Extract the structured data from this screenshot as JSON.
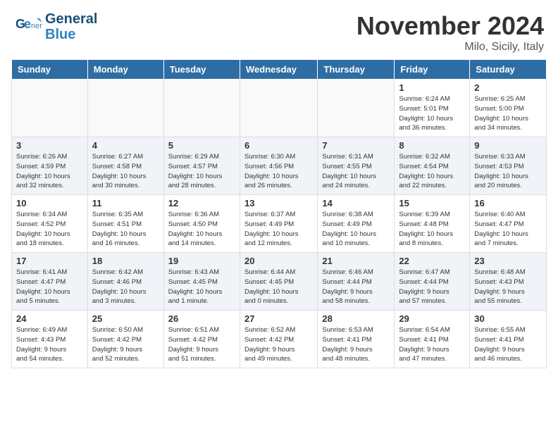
{
  "header": {
    "logo_line1": "General",
    "logo_line2": "Blue",
    "month": "November 2024",
    "location": "Milo, Sicily, Italy"
  },
  "days_of_week": [
    "Sunday",
    "Monday",
    "Tuesday",
    "Wednesday",
    "Thursday",
    "Friday",
    "Saturday"
  ],
  "weeks": [
    [
      {
        "num": "",
        "info": ""
      },
      {
        "num": "",
        "info": ""
      },
      {
        "num": "",
        "info": ""
      },
      {
        "num": "",
        "info": ""
      },
      {
        "num": "",
        "info": ""
      },
      {
        "num": "1",
        "info": "Sunrise: 6:24 AM\nSunset: 5:01 PM\nDaylight: 10 hours\nand 36 minutes."
      },
      {
        "num": "2",
        "info": "Sunrise: 6:25 AM\nSunset: 5:00 PM\nDaylight: 10 hours\nand 34 minutes."
      }
    ],
    [
      {
        "num": "3",
        "info": "Sunrise: 6:26 AM\nSunset: 4:59 PM\nDaylight: 10 hours\nand 32 minutes."
      },
      {
        "num": "4",
        "info": "Sunrise: 6:27 AM\nSunset: 4:58 PM\nDaylight: 10 hours\nand 30 minutes."
      },
      {
        "num": "5",
        "info": "Sunrise: 6:29 AM\nSunset: 4:57 PM\nDaylight: 10 hours\nand 28 minutes."
      },
      {
        "num": "6",
        "info": "Sunrise: 6:30 AM\nSunset: 4:56 PM\nDaylight: 10 hours\nand 26 minutes."
      },
      {
        "num": "7",
        "info": "Sunrise: 6:31 AM\nSunset: 4:55 PM\nDaylight: 10 hours\nand 24 minutes."
      },
      {
        "num": "8",
        "info": "Sunrise: 6:32 AM\nSunset: 4:54 PM\nDaylight: 10 hours\nand 22 minutes."
      },
      {
        "num": "9",
        "info": "Sunrise: 6:33 AM\nSunset: 4:53 PM\nDaylight: 10 hours\nand 20 minutes."
      }
    ],
    [
      {
        "num": "10",
        "info": "Sunrise: 6:34 AM\nSunset: 4:52 PM\nDaylight: 10 hours\nand 18 minutes."
      },
      {
        "num": "11",
        "info": "Sunrise: 6:35 AM\nSunset: 4:51 PM\nDaylight: 10 hours\nand 16 minutes."
      },
      {
        "num": "12",
        "info": "Sunrise: 6:36 AM\nSunset: 4:50 PM\nDaylight: 10 hours\nand 14 minutes."
      },
      {
        "num": "13",
        "info": "Sunrise: 6:37 AM\nSunset: 4:49 PM\nDaylight: 10 hours\nand 12 minutes."
      },
      {
        "num": "14",
        "info": "Sunrise: 6:38 AM\nSunset: 4:49 PM\nDaylight: 10 hours\nand 10 minutes."
      },
      {
        "num": "15",
        "info": "Sunrise: 6:39 AM\nSunset: 4:48 PM\nDaylight: 10 hours\nand 8 minutes."
      },
      {
        "num": "16",
        "info": "Sunrise: 6:40 AM\nSunset: 4:47 PM\nDaylight: 10 hours\nand 7 minutes."
      }
    ],
    [
      {
        "num": "17",
        "info": "Sunrise: 6:41 AM\nSunset: 4:47 PM\nDaylight: 10 hours\nand 5 minutes."
      },
      {
        "num": "18",
        "info": "Sunrise: 6:42 AM\nSunset: 4:46 PM\nDaylight: 10 hours\nand 3 minutes."
      },
      {
        "num": "19",
        "info": "Sunrise: 6:43 AM\nSunset: 4:45 PM\nDaylight: 10 hours\nand 1 minute."
      },
      {
        "num": "20",
        "info": "Sunrise: 6:44 AM\nSunset: 4:45 PM\nDaylight: 10 hours\nand 0 minutes."
      },
      {
        "num": "21",
        "info": "Sunrise: 6:46 AM\nSunset: 4:44 PM\nDaylight: 9 hours\nand 58 minutes."
      },
      {
        "num": "22",
        "info": "Sunrise: 6:47 AM\nSunset: 4:44 PM\nDaylight: 9 hours\nand 57 minutes."
      },
      {
        "num": "23",
        "info": "Sunrise: 6:48 AM\nSunset: 4:43 PM\nDaylight: 9 hours\nand 55 minutes."
      }
    ],
    [
      {
        "num": "24",
        "info": "Sunrise: 6:49 AM\nSunset: 4:43 PM\nDaylight: 9 hours\nand 54 minutes."
      },
      {
        "num": "25",
        "info": "Sunrise: 6:50 AM\nSunset: 4:42 PM\nDaylight: 9 hours\nand 52 minutes."
      },
      {
        "num": "26",
        "info": "Sunrise: 6:51 AM\nSunset: 4:42 PM\nDaylight: 9 hours\nand 51 minutes."
      },
      {
        "num": "27",
        "info": "Sunrise: 6:52 AM\nSunset: 4:42 PM\nDaylight: 9 hours\nand 49 minutes."
      },
      {
        "num": "28",
        "info": "Sunrise: 6:53 AM\nSunset: 4:41 PM\nDaylight: 9 hours\nand 48 minutes."
      },
      {
        "num": "29",
        "info": "Sunrise: 6:54 AM\nSunset: 4:41 PM\nDaylight: 9 hours\nand 47 minutes."
      },
      {
        "num": "30",
        "info": "Sunrise: 6:55 AM\nSunset: 4:41 PM\nDaylight: 9 hours\nand 46 minutes."
      }
    ]
  ]
}
